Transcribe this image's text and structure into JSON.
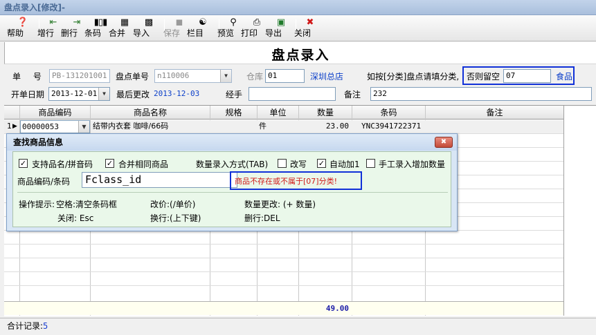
{
  "window": {
    "title": "盘点录入[修改]-"
  },
  "toolbar": {
    "items": [
      {
        "label": "帮助",
        "icon": "help"
      },
      {
        "label": "增行",
        "icon": "add-row"
      },
      {
        "label": "删行",
        "icon": "delete-row"
      },
      {
        "label": "条码",
        "icon": "barcode"
      },
      {
        "label": "合并",
        "icon": "merge"
      },
      {
        "label": "导入",
        "icon": "import"
      },
      {
        "label": "保存",
        "icon": "save",
        "disabled": true
      },
      {
        "label": "栏目",
        "icon": "columns"
      },
      {
        "label": "预览",
        "icon": "preview"
      },
      {
        "label": "打印",
        "icon": "print"
      },
      {
        "label": "导出",
        "icon": "export"
      },
      {
        "label": "关闭",
        "icon": "close"
      }
    ]
  },
  "form": {
    "title": "盘点录入",
    "doc_no_label": "单 号",
    "doc_no_value": "PB-131201001",
    "inv_no_label": "盘点单号",
    "inv_no_value": "n110006",
    "warehouse_label": "仓库",
    "warehouse_code": "01",
    "warehouse_name": "深圳总店",
    "hint_label": "如按[分类]盘点请填分类,",
    "else_blank_label": "否则留空",
    "category_code": "07",
    "category_name": "食品",
    "open_date_label": "开单日期",
    "open_date_value": "2013-12-01",
    "last_modified_label": "最后更改",
    "last_modified_value": "2013-12-03",
    "handler_label": "经手",
    "handler_value": "",
    "remark_label": "备注",
    "remark_value": "232"
  },
  "grid": {
    "columns": [
      "商品编码",
      "商品名称",
      "规格",
      "单位",
      "数量",
      "条码",
      "备注"
    ],
    "rows": [
      {
        "index": "1",
        "code": "00000053",
        "name": "结带内衣套 咖啡/66码",
        "spec": "",
        "unit": "件",
        "qty": "23.00",
        "barcode": "YNC3941722371",
        "remark": ""
      }
    ],
    "total_qty": "49.00"
  },
  "status": {
    "label": "合计记录:",
    "count": "5"
  },
  "dialog": {
    "title": "查找商品信息",
    "support_pinyin_label": "支持品名/拼音码",
    "support_pinyin_checked": true,
    "merge_same_label": "合并相同商品",
    "merge_same_checked": true,
    "qty_mode_label": "数量录入方式(TAB)",
    "rewrite_label": "改写",
    "rewrite_checked": false,
    "auto_add_label": "自动加1",
    "auto_add_checked": true,
    "manual_add_label": "手工录入增加数量",
    "manual_add_checked": false,
    "code_label": "商品编码/条码",
    "code_value": "Fclass_id",
    "error_text": "商品不存在或不属于[07]分类!",
    "tips_title": "操作提示:",
    "tip_space": "空格:清空条码框",
    "tip_price": "改价:(/单价)",
    "tip_qty": "数量更改: (+ 数量)",
    "tip_close": "关闭: Esc",
    "tip_newline": "换行:(上下键)",
    "tip_delete": "删行:DEL"
  }
}
